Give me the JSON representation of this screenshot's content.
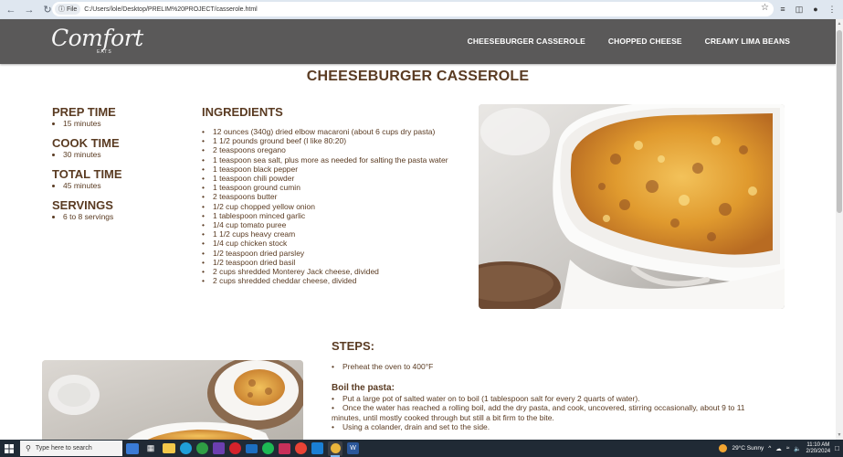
{
  "browser": {
    "file_chip": "File",
    "url": "C:/Users/lole/Desktop/PRELIM%20PROJECT/casserole.html"
  },
  "site": {
    "logo_script": "Comfort",
    "logo_sub": "EATS",
    "nav": [
      "CHEESEBURGER CASSEROLE",
      "CHOPPED CHEESE",
      "CREAMY LIMA BEANS"
    ]
  },
  "page": {
    "title": "CHEESEBURGER CASSEROLE",
    "times": [
      {
        "heading": "PREP TIME",
        "value": "15 minutes"
      },
      {
        "heading": "COOK TIME",
        "value": "30 minutes"
      },
      {
        "heading": "TOTAL TIME",
        "value": "45 minutes"
      },
      {
        "heading": "SERVINGS",
        "value": "6 to 8 servings"
      }
    ],
    "ingredients_heading": "INGREDIENTS",
    "ingredients": [
      "12 ounces (340g) dried elbow macaroni (about 6 cups dry pasta)",
      "1 1/2 pounds ground beef (I like 80:20)",
      "2 teaspoons oregano",
      "1 teaspoon sea salt, plus more as needed for salting the pasta water",
      "1 teaspoon black pepper",
      "1 teaspoon chili powder",
      "1 teaspoon ground cumin",
      "2 teaspoons butter",
      "1/2 cup chopped yellow onion",
      "1 tablespoon minced garlic",
      "1/4 cup tomato puree",
      "1 1/2 cups heavy cream",
      "1/4 cup chicken stock",
      "1/2 teaspoon dried parsley",
      "1/2 teaspoon dried basil",
      "2 cups shredded Monterey Jack cheese, divided",
      "2 cups shredded cheddar cheese, divided"
    ],
    "steps_heading": "STEPS:",
    "steps_intro": [
      "Preheat the oven to 400°F"
    ],
    "boil_heading": "Boil the pasta:",
    "boil_steps": [
      "Put a large pot of salted water on to boil (1 tablespoon salt for every 2 quarts of water).",
      "Once the water has reached a rolling boil, add the dry pasta, and cook, uncovered, stirring occasionally, about 9 to 11 minutes, until mostly cooked through but still a bit firm to the bite.",
      "Using a colander, drain and set to the side."
    ]
  },
  "taskbar": {
    "search_placeholder": "Type here to search",
    "weather": "29°C  Sunny",
    "time": "11:10 AM",
    "date": "2/20/2024",
    "apps": [
      "file-explorer-icon",
      "edge-icon",
      "chrome-icon",
      "vs-icon",
      "opera-icon",
      "mail-icon",
      "spotify-icon",
      "store-icon",
      "chrome-alt-icon",
      "vscode-icon",
      "chrome-active-icon",
      "word-icon"
    ]
  },
  "colors": {
    "header_bg": "#5a5959",
    "text_brown": "#5a3b22",
    "taskbar_bg": "#202a35"
  }
}
